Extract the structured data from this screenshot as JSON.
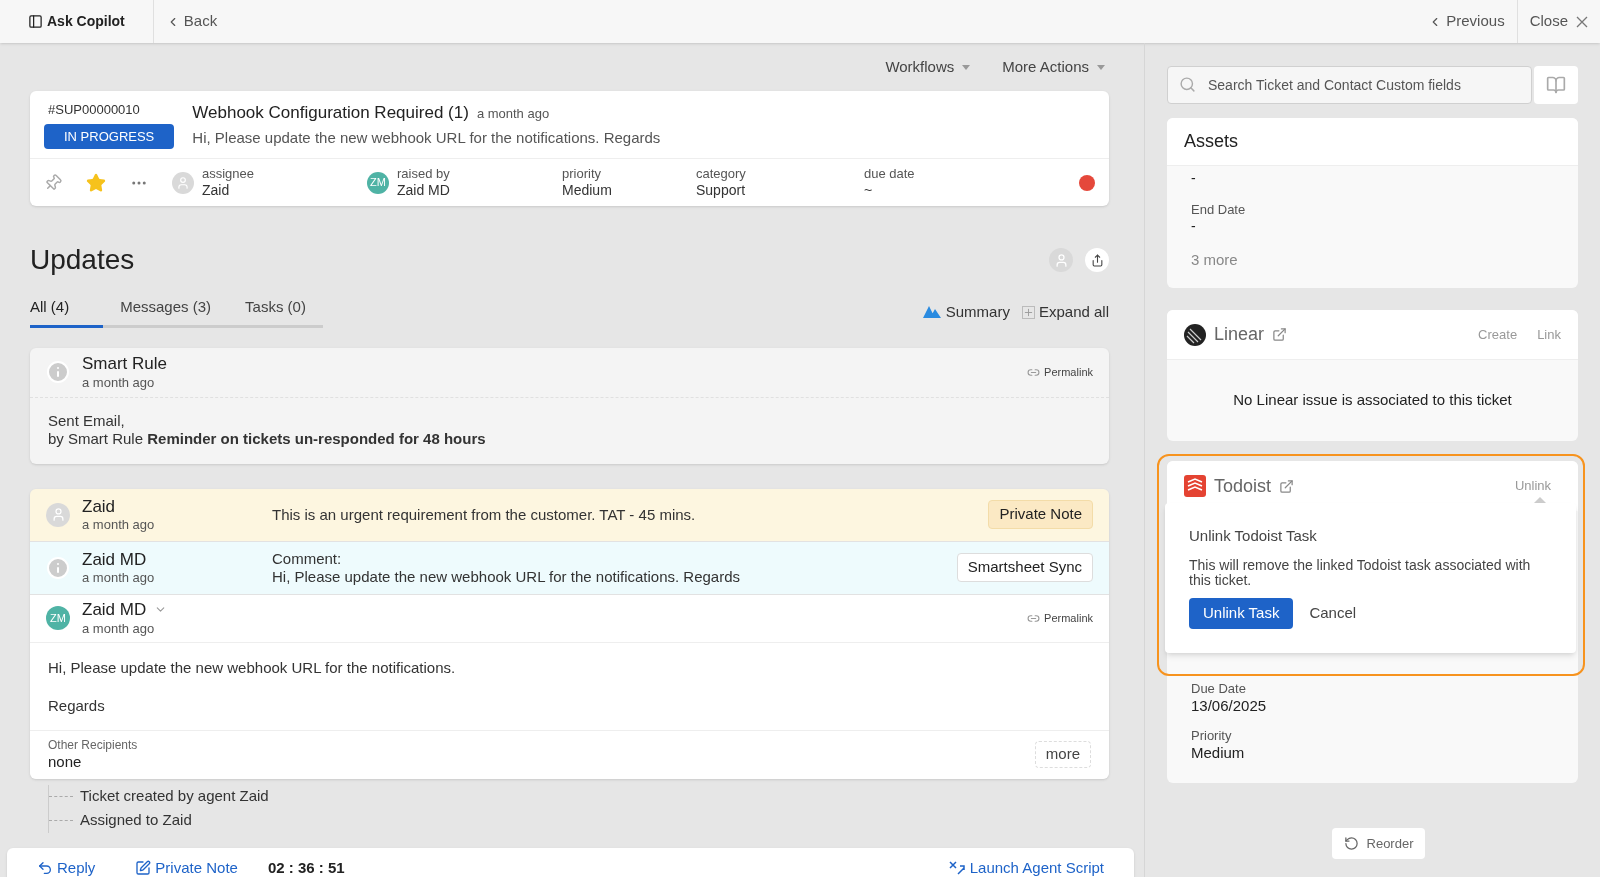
{
  "topbar": {
    "copilot": "Ask Copilot",
    "back": "Back",
    "previous": "Previous",
    "close": "Close"
  },
  "actions": [
    {
      "label": "Workflows"
    },
    {
      "label": "More Actions"
    }
  ],
  "ticket": {
    "id": "#SUP00000010",
    "status": "IN PROGRESS",
    "title": "Webhook Configuration Required (1)",
    "time": "a month ago",
    "summary": "Hi, Please update the new webhook URL for the notifications. Regards",
    "starred": true,
    "fields": [
      {
        "kind": "avatar",
        "label": "assignee",
        "value": "Zaid"
      },
      {
        "kind": "initials",
        "initials": "ZM",
        "label": "raised by",
        "value": "Zaid MD"
      },
      {
        "kind": "plain",
        "label": "priority",
        "value": "Medium"
      },
      {
        "kind": "plain",
        "label": "category",
        "value": "Support"
      },
      {
        "kind": "plain",
        "label": "due date",
        "value": "~"
      }
    ]
  },
  "updates": {
    "title": "Updates",
    "tabs": [
      {
        "label": "All (4)",
        "selected": true
      },
      {
        "label": "Messages (3)",
        "selected": false
      },
      {
        "label": "Tasks (0)",
        "selected": false
      }
    ],
    "summary": "Summary",
    "expand": "Expand all"
  },
  "smart_rule": {
    "name": "Smart Rule",
    "time": "a month ago",
    "permalink": "Permalink",
    "lines": [
      "Sent Email,",
      "by Smart Rule **Reminder on tickets un-responded for 48 hours**"
    ]
  },
  "notes": [
    {
      "kind": "private",
      "name": "Zaid",
      "time": "a month ago",
      "text": "This is an urgent requirement from the customer. TAT - 45 mins.",
      "tag": "Private Note"
    },
    {
      "kind": "comment",
      "name": "Zaid MD",
      "time": "a month ago",
      "label": "Comment:",
      "text": "Hi, Please update the new webhook URL for the notifications. Regards",
      "tag": "Smartsheet Sync"
    }
  ],
  "message": {
    "initials": "ZM",
    "name": "Zaid MD",
    "time": "a month ago",
    "permalink": "Permalink",
    "body": [
      "Hi, Please update the new webhook URL for the notifications.",
      "Regards"
    ],
    "recipients_label": "Other Recipients",
    "recipients": "none",
    "more": "more"
  },
  "timeline": [
    "Ticket created by agent Zaid",
    "Assigned to Zaid"
  ],
  "composer": {
    "reply": "Reply",
    "private_note": "Private Note",
    "timer": "02 : 36 : 51",
    "launch": "Launch Agent Script"
  },
  "sidebar": {
    "search": {
      "placeholder": "Search Ticket and Contact Custom fields"
    },
    "assets": {
      "title": "Assets",
      "fields": [
        {
          "value": "-"
        },
        {
          "label": "End Date",
          "value": "-"
        }
      ],
      "more": "3 more"
    },
    "linear": {
      "title": "Linear",
      "create": "Create",
      "link": "Link",
      "empty": "No Linear issue is associated to this ticket"
    },
    "todoist": {
      "title": "Todoist",
      "unlink": "Unlink",
      "fields": [
        {
          "label": "Due Date",
          "value": "13/06/2025"
        },
        {
          "label": "Priority",
          "value": "Medium"
        }
      ],
      "popover": {
        "title": "Unlink Todoist Task",
        "text": "This will remove the linked Todoist task associated with this ticket.",
        "confirm": "Unlink Task",
        "cancel": "Cancel"
      }
    },
    "reorder": "Reorder"
  }
}
